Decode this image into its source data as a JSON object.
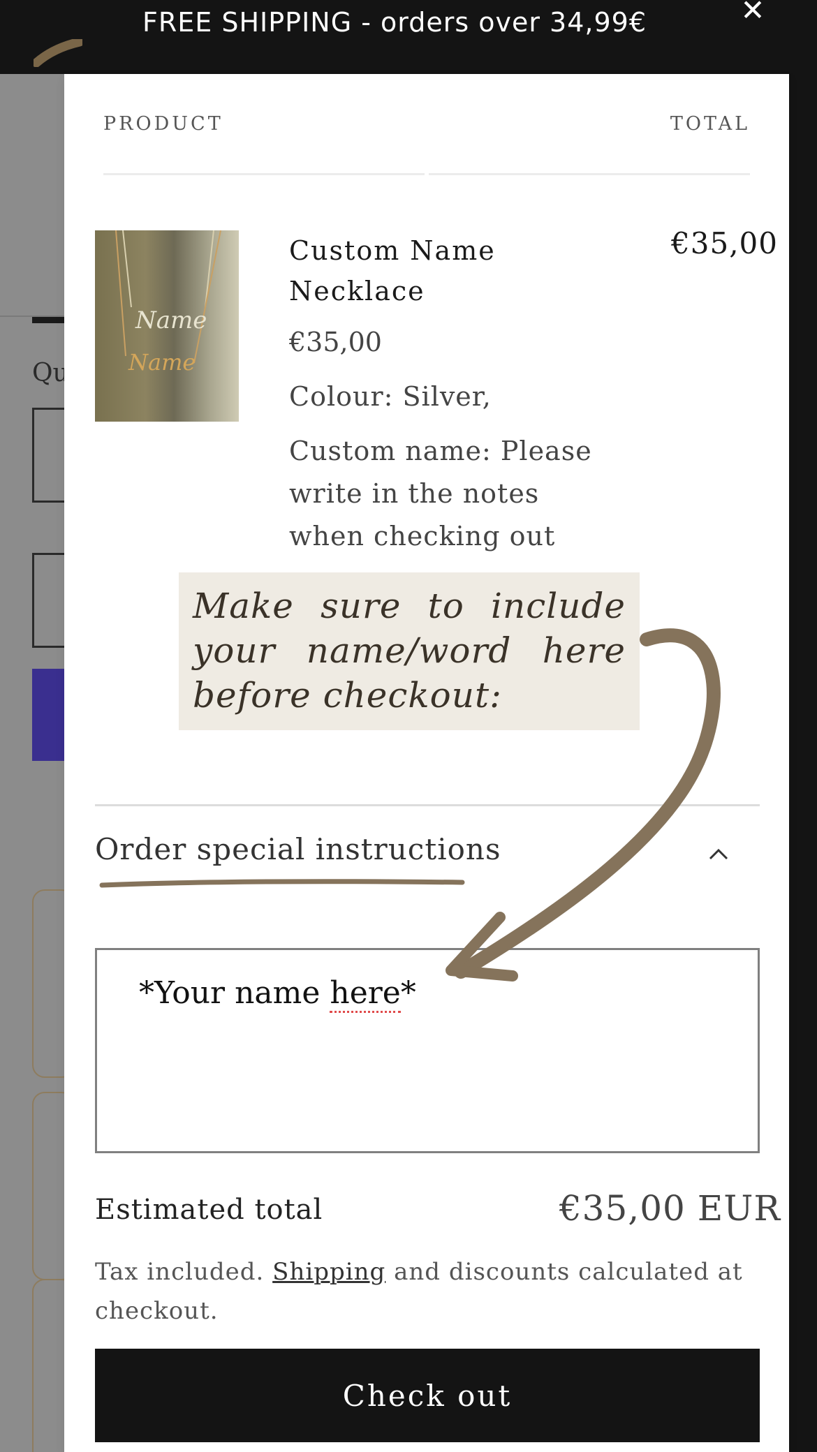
{
  "announcement": {
    "text": "FREE SHIPPING - orders over 34,99€",
    "close_label": "✕"
  },
  "background_page": {
    "quantity_label_fragment": "Qu"
  },
  "cart": {
    "columns": {
      "product": "PRODUCT",
      "total": "TOTAL"
    },
    "item": {
      "name": "Custom Name Necklace",
      "price": "€35,00",
      "line_total": "€35,00",
      "colour": "Colour: Silver,",
      "custom_name": "Custom name: Please write in the notes when checking out",
      "thumbnail_words": [
        "Name",
        "Name"
      ]
    },
    "note_callout": "Make sure to include your name/word here before checkout:",
    "instructions": {
      "label": "Order special instructions",
      "value_prefix": "*Your name ",
      "value_flagged": "here",
      "value_suffix": "*"
    },
    "estimated_total": {
      "label": "Estimated total",
      "value": "€35,00 EUR"
    },
    "tax": {
      "before": "Tax included. ",
      "link": "Shipping",
      "after": " and discounts calculated at checkout."
    },
    "checkout_label": "Check out"
  },
  "icons": [
    "close-icon",
    "brush-logo-icon",
    "chevron-up-icon",
    "arrow-annotation-icon"
  ],
  "colors": {
    "bar": "#141414",
    "callout_bg": "#efebe3",
    "annotation_brown": "#85735b",
    "background_accent": "#3a2f8f"
  }
}
